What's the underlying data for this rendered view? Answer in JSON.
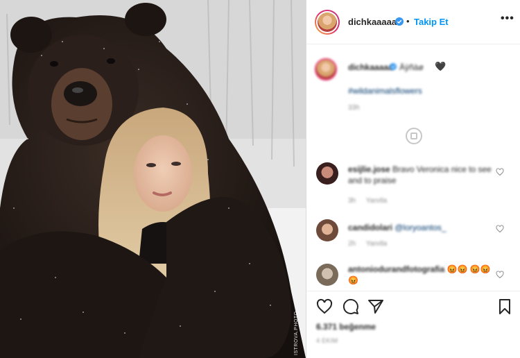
{
  "post": {
    "username": "dichkaaaaa",
    "dot": "•",
    "follow_label": "Takip Et",
    "more_label": "•••",
    "photo_watermark": "ISTROVA.PHOTO"
  },
  "caption": {
    "username": "dichkaaaaa",
    "text": "Äÿñàø",
    "heart": "🖤",
    "hashtag": "#wildanimalsflowers",
    "time": "33h"
  },
  "comments": [
    {
      "username": "esijlie.jose",
      "text": "Bravo Veronica nice to see and to praise",
      "time": "3h",
      "reply_label": "Yanıtla"
    },
    {
      "username": "candidolari",
      "text": "@loryoantos_",
      "time": "2h",
      "reply_label": "Yanıtla"
    },
    {
      "username": "antoniodurandfotografia",
      "text": "😡😡 😡😡😡",
      "time": "",
      "reply_label": ""
    }
  ],
  "footer": {
    "likes": "6.371 beğenme",
    "date": "4 EKIM"
  },
  "colors": {
    "accent": "#0095f6",
    "verified": "#3897f0",
    "muted": "#8e8e8e",
    "text": "#262626"
  },
  "icons": {
    "verified": "verified-badge-icon",
    "more": "more-options-icon",
    "like": "heart-outline-icon",
    "comment": "comment-bubble-icon",
    "share": "paper-plane-icon",
    "save": "bookmark-icon",
    "load_more": "plus-circle-icon"
  }
}
